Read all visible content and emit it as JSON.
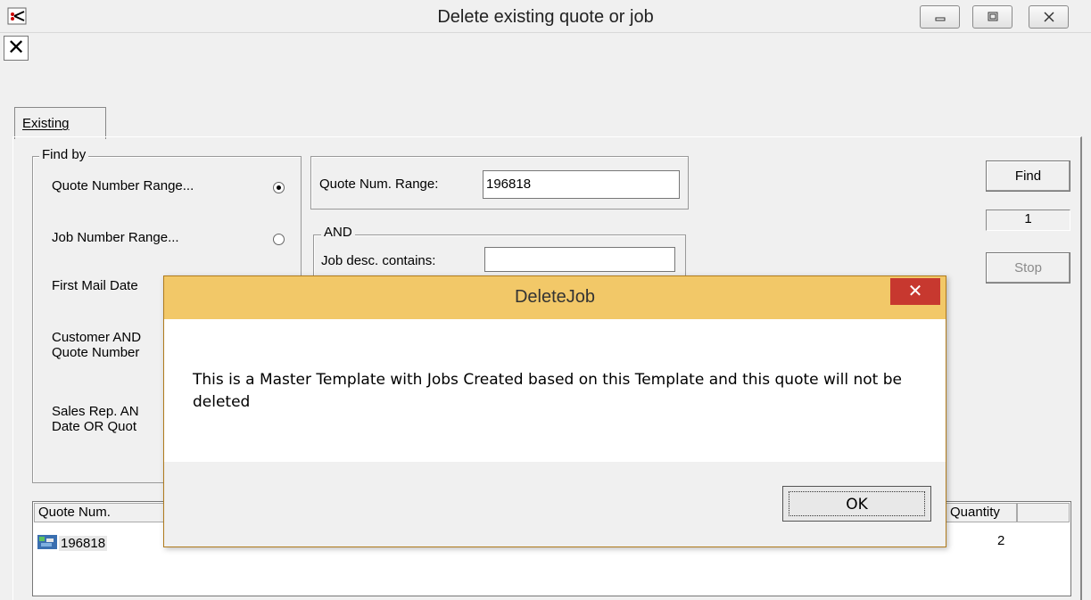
{
  "window": {
    "title": "Delete existing quote or job",
    "toolbar_close": "✕"
  },
  "tab": {
    "label": "Existing"
  },
  "find_by": {
    "legend": "Find by",
    "options": [
      {
        "label": "Quote Number Range...",
        "selected": true
      },
      {
        "label": "Job Number Range...",
        "selected": false
      },
      {
        "label": "First Mail Date"
      },
      {
        "label_line1": "Customer AND",
        "label_line2": "Quote Number"
      },
      {
        "label_line1": "Sales Rep. AN",
        "label_line2": "Date OR Quot"
      }
    ]
  },
  "criteria": {
    "quote_range_label": "Quote Num. Range:",
    "quote_range_value": "196818",
    "and_legend": "AND",
    "job_desc_label": "Job desc. contains:",
    "job_desc_value": ""
  },
  "actions": {
    "find_label": "Find",
    "count_value": "1",
    "stop_label": "Stop"
  },
  "results": {
    "columns": [
      "Quote Num.",
      "Quantity"
    ],
    "rows": [
      {
        "quote_num": "196818",
        "quantity": "2"
      }
    ]
  },
  "dialog": {
    "title": "DeleteJob",
    "close": "✕",
    "message": "This is a Master Template with Jobs Created based on this Template and this quote will not be deleted",
    "ok_label": "OK"
  }
}
